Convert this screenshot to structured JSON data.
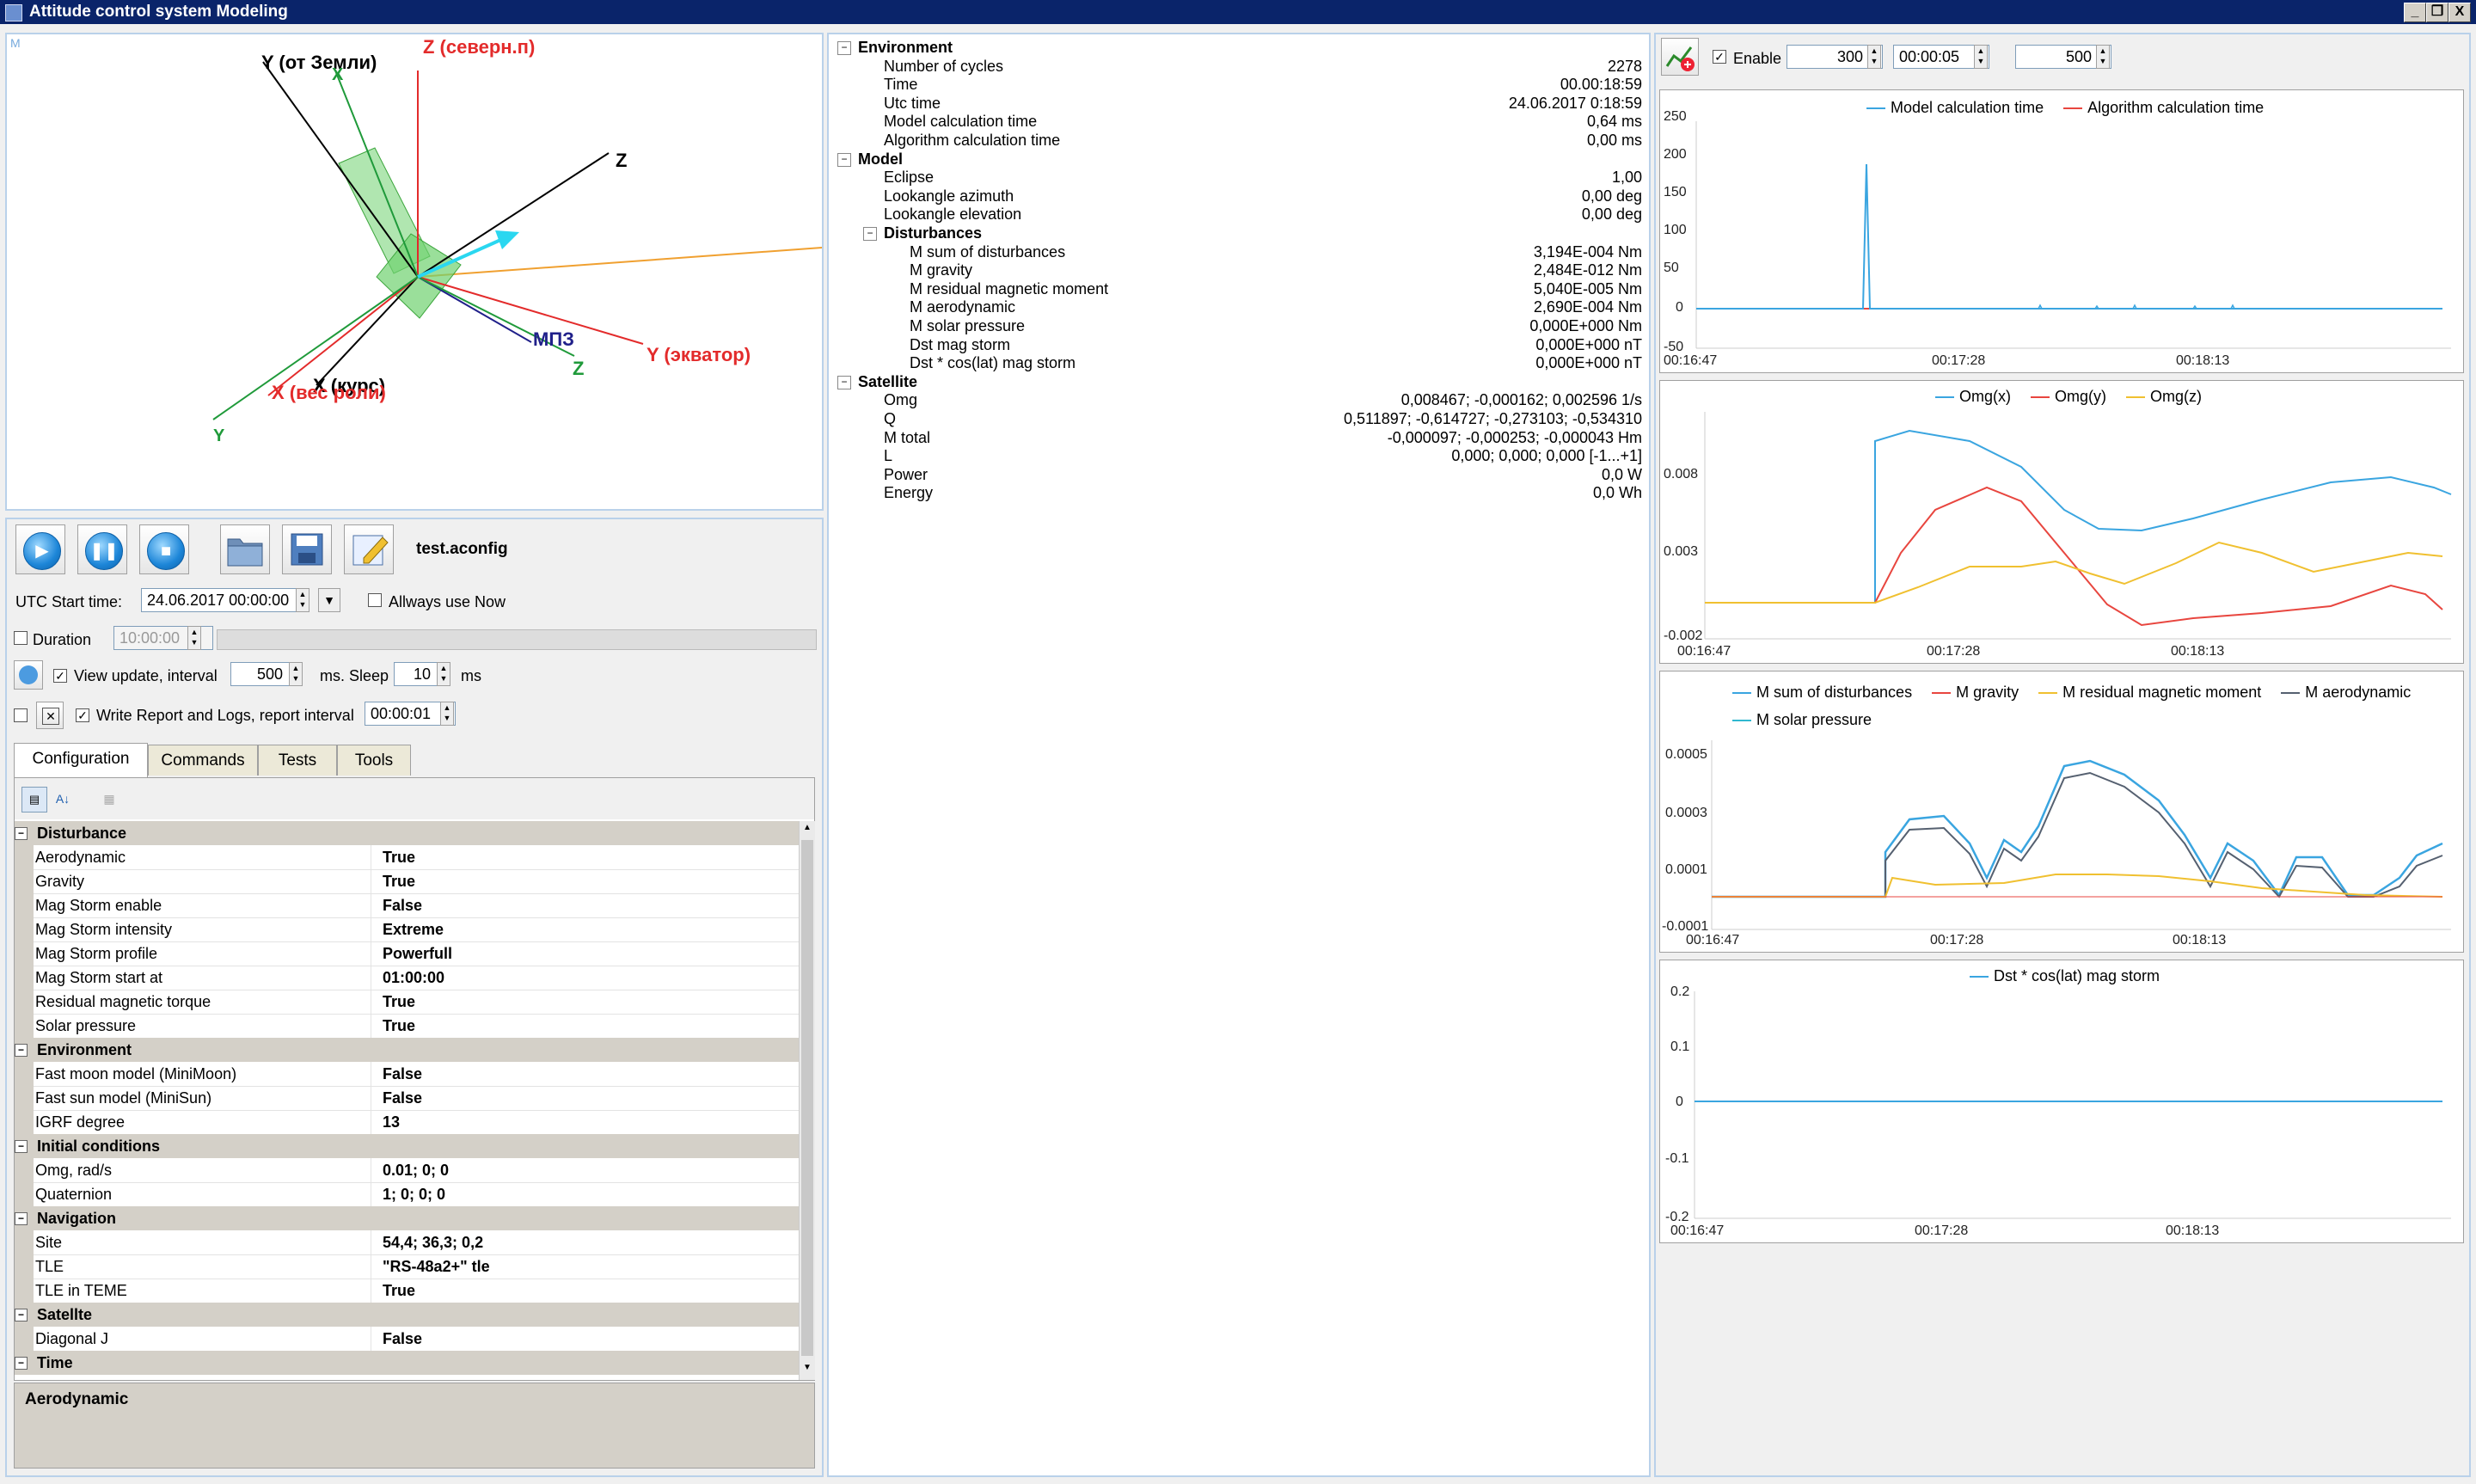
{
  "window": {
    "title": "Attitude control system Modeling",
    "min": "_",
    "max": "❐",
    "close": "X"
  },
  "scene": {
    "corner_label": "M",
    "axes": [
      {
        "label": "Y (от Земли)",
        "color": "#000000"
      },
      {
        "label": "Z (северн.п)",
        "color": "#e32b2b"
      },
      {
        "label": "Z",
        "color": "#000000"
      },
      {
        "label": "Y (экватор)",
        "color": "#e32b2b"
      },
      {
        "label": "МПЗ",
        "color": "#20208a"
      },
      {
        "label": "Z",
        "color": "#1f9a3a"
      },
      {
        "label": "X (курс)",
        "color": "#000000"
      },
      {
        "label": "X (вес роли)",
        "color": "#e32b2b"
      },
      {
        "label": "Y",
        "color": "#1f9a3a"
      },
      {
        "label": "X",
        "color": "#1f9a3a"
      }
    ]
  },
  "toolbar": {
    "play_icon": "play-icon",
    "pause_icon": "pause-icon",
    "stop_icon": "stop-icon",
    "open_icon": "folder-icon",
    "save_icon": "save-icon",
    "edit_icon": "edit-icon",
    "config_name": "test.aconfig"
  },
  "controls": {
    "utc_label": "UTC Start time:",
    "utc_value": "24.06.2017 00:00:00",
    "always_now": "Allways use Now",
    "duration_label": "Duration",
    "duration_value": "10:00:00",
    "view_update_label": "View update, interval",
    "interval_value": "500",
    "ms_sleep": "ms. Sleep",
    "sleep_value": "10",
    "ms": "ms",
    "report_label": "Write Report and Logs, report interval",
    "report_value": "00:00:01"
  },
  "tabs": [
    "Configuration",
    "Commands",
    "Tests",
    "Tools"
  ],
  "properties": [
    {
      "category": "Disturbance",
      "rows": [
        {
          "name": "Aerodynamic",
          "value": "True"
        },
        {
          "name": "Gravity",
          "value": "True"
        },
        {
          "name": "Mag Storm enable",
          "value": "False"
        },
        {
          "name": "Mag Storm intensity",
          "value": "Extreme"
        },
        {
          "name": "Mag Storm profile",
          "value": "Powerfull"
        },
        {
          "name": "Mag Storm start at",
          "value": "01:00:00"
        },
        {
          "name": "Residual magnetic torque",
          "value": "True"
        },
        {
          "name": "Solar pressure",
          "value": "True"
        }
      ]
    },
    {
      "category": "Environment",
      "rows": [
        {
          "name": "Fast moon model (MiniMoon)",
          "value": "False"
        },
        {
          "name": "Fast sun model (MiniSun)",
          "value": "False"
        },
        {
          "name": "IGRF degree",
          "value": "13"
        }
      ]
    },
    {
      "category": "Initial conditions",
      "rows": [
        {
          "name": "Omg, rad/s",
          "value": "0.01; 0; 0"
        },
        {
          "name": "Quaternion",
          "value": "1; 0; 0; 0"
        }
      ]
    },
    {
      "category": "Navigation",
      "rows": [
        {
          "name": "Site",
          "value": "54,4; 36,3; 0,2"
        },
        {
          "name": "TLE",
          "value": "\"RS-48a2+\" tle"
        },
        {
          "name": "TLE in TEME",
          "value": "True"
        }
      ]
    },
    {
      "category": "Satellte",
      "rows": [
        {
          "name": "Diagonal J",
          "value": "False"
        }
      ]
    },
    {
      "category": "Time",
      "rows": []
    }
  ],
  "description": {
    "title": "Aerodynamic"
  },
  "tree": [
    {
      "level": 0,
      "label": "Environment",
      "value": "",
      "group": true
    },
    {
      "level": 1,
      "label": "Number of cycles",
      "value": "2278"
    },
    {
      "level": 1,
      "label": "Time",
      "value": "00.00:18:59"
    },
    {
      "level": 1,
      "label": "Utc time",
      "value": "24.06.2017 0:18:59"
    },
    {
      "level": 1,
      "label": "Model calculation time",
      "value": "0,64 ms"
    },
    {
      "level": 1,
      "label": "Algorithm calculation time",
      "value": "0,00 ms"
    },
    {
      "level": 0,
      "label": "Model",
      "value": "",
      "group": true
    },
    {
      "level": 1,
      "label": "Eclipse",
      "value": "1,00"
    },
    {
      "level": 1,
      "label": "Lookangle azimuth",
      "value": "0,00 deg"
    },
    {
      "level": 1,
      "label": "Lookangle elevation",
      "value": "0,00 deg"
    },
    {
      "level": 1,
      "label": "Disturbances",
      "value": "",
      "group": true
    },
    {
      "level": 2,
      "label": "M sum of disturbances",
      "value": "3,194E-004 Nm"
    },
    {
      "level": 2,
      "label": "M gravity",
      "value": "2,484E-012 Nm"
    },
    {
      "level": 2,
      "label": "M residual magnetic moment",
      "value": "5,040E-005 Nm"
    },
    {
      "level": 2,
      "label": "M aerodynamic",
      "value": "2,690E-004 Nm"
    },
    {
      "level": 2,
      "label": "M solar pressure",
      "value": "0,000E+000 Nm"
    },
    {
      "level": 2,
      "label": "Dst mag storm",
      "value": "0,000E+000 nT"
    },
    {
      "level": 2,
      "label": "Dst * cos(lat) mag storm",
      "value": "0,000E+000 nT"
    },
    {
      "level": 0,
      "label": "Satellite",
      "value": "",
      "group": true
    },
    {
      "level": 1,
      "label": "Omg",
      "value": "0,008467; -0,000162; 0,002596 1/s"
    },
    {
      "level": 1,
      "label": "Q",
      "value": "0,511897; -0,614727; -0,273103; -0,534310"
    },
    {
      "level": 1,
      "label": "M total",
      "value": "-0,000097; -0,000253; -0,000043 Hm"
    },
    {
      "level": 1,
      "label": "L",
      "value": "0,000; 0,000; 0,000 [-1...+1]"
    },
    {
      "level": 1,
      "label": "Power",
      "value": "0,0 W"
    },
    {
      "level": 1,
      "label": "Energy",
      "value": "0,0 Wh"
    }
  ],
  "chart_toolbar": {
    "enable": "Enable",
    "points": "300",
    "window": "00:00:05",
    "interval": "500"
  },
  "charts": [
    {
      "legend": [
        {
          "name": "Model calculation time",
          "color": "#3aa5e0"
        },
        {
          "name": "Algorithm calculation time",
          "color": "#e8463f"
        }
      ],
      "yticks": [
        "250",
        "200",
        "150",
        "100",
        "50",
        "0",
        "-50"
      ],
      "xticks": [
        "00:16:47",
        "00:17:28",
        "00:18:13"
      ]
    },
    {
      "legend": [
        {
          "name": "Omg(x)",
          "color": "#3aa5e0"
        },
        {
          "name": "Omg(y)",
          "color": "#e8463f"
        },
        {
          "name": "Omg(z)",
          "color": "#f0c030"
        }
      ],
      "yticks": [
        "0.008",
        "0.003",
        "-0.002"
      ],
      "xticks": [
        "00:16:47",
        "00:17:28",
        "00:18:13"
      ]
    },
    {
      "legend": [
        {
          "name": "M sum of disturbances",
          "color": "#3aa5e0"
        },
        {
          "name": "M gravity",
          "color": "#e8463f"
        },
        {
          "name": "M residual magnetic moment",
          "color": "#f0c030"
        },
        {
          "name": "M aerodynamic",
          "color": "#556070"
        },
        {
          "name": "M solar pressure",
          "color": "#30b8d0"
        }
      ],
      "yticks": [
        "0.0005",
        "0.0003",
        "0.0001",
        "-0.0001"
      ],
      "xticks": [
        "00:16:47",
        "00:17:28",
        "00:18:13"
      ]
    },
    {
      "legend": [
        {
          "name": "Dst * cos(lat) mag storm",
          "color": "#3aa5e0"
        }
      ],
      "yticks": [
        "0.2",
        "0.1",
        "0",
        "-0.1",
        "-0.2"
      ],
      "xticks": [
        "00:16:47",
        "00:17:28",
        "00:18:13"
      ]
    }
  ]
}
